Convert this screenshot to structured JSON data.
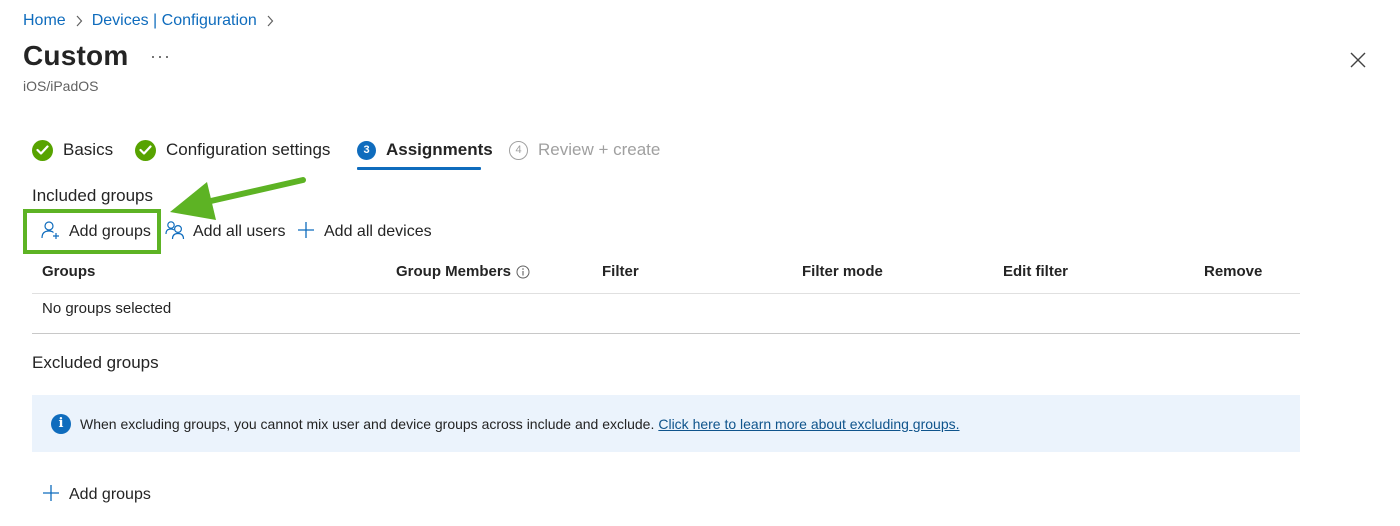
{
  "breadcrumb": [
    "Home",
    "Devices | Configuration"
  ],
  "header": {
    "title": "Custom",
    "more_label": "···",
    "subtitle": "iOS/iPadOS"
  },
  "steps": [
    {
      "label": "Basics",
      "state": "done"
    },
    {
      "label": "Configuration settings",
      "state": "done"
    },
    {
      "number": "3",
      "label": "Assignments",
      "state": "current"
    },
    {
      "number": "4",
      "label": "Review + create",
      "state": "future"
    }
  ],
  "included": {
    "title": "Included groups",
    "commands": {
      "add_groups": "Add groups",
      "add_all_users": "Add all users",
      "add_all_devices": "Add all devices"
    },
    "columns": [
      "Groups",
      "Group Members",
      "Filter",
      "Filter mode",
      "Edit filter",
      "Remove"
    ],
    "empty_text": "No groups selected"
  },
  "excluded": {
    "title": "Excluded groups",
    "info_text": "When excluding groups, you cannot mix user and device groups across include and exclude.",
    "info_link": "Click here to learn more about excluding groups.",
    "add_groups": "Add groups"
  },
  "colors": {
    "accent": "#0f6cbd",
    "success": "#57a300",
    "annotation": "#5db324",
    "info_bg": "#ebf3fc"
  },
  "icons": [
    "chevron-right-icon",
    "more-icon",
    "close-icon",
    "checkmark-icon",
    "info-icon",
    "person-add-icon",
    "people-icon",
    "plus-icon",
    "arrow-annotation"
  ]
}
